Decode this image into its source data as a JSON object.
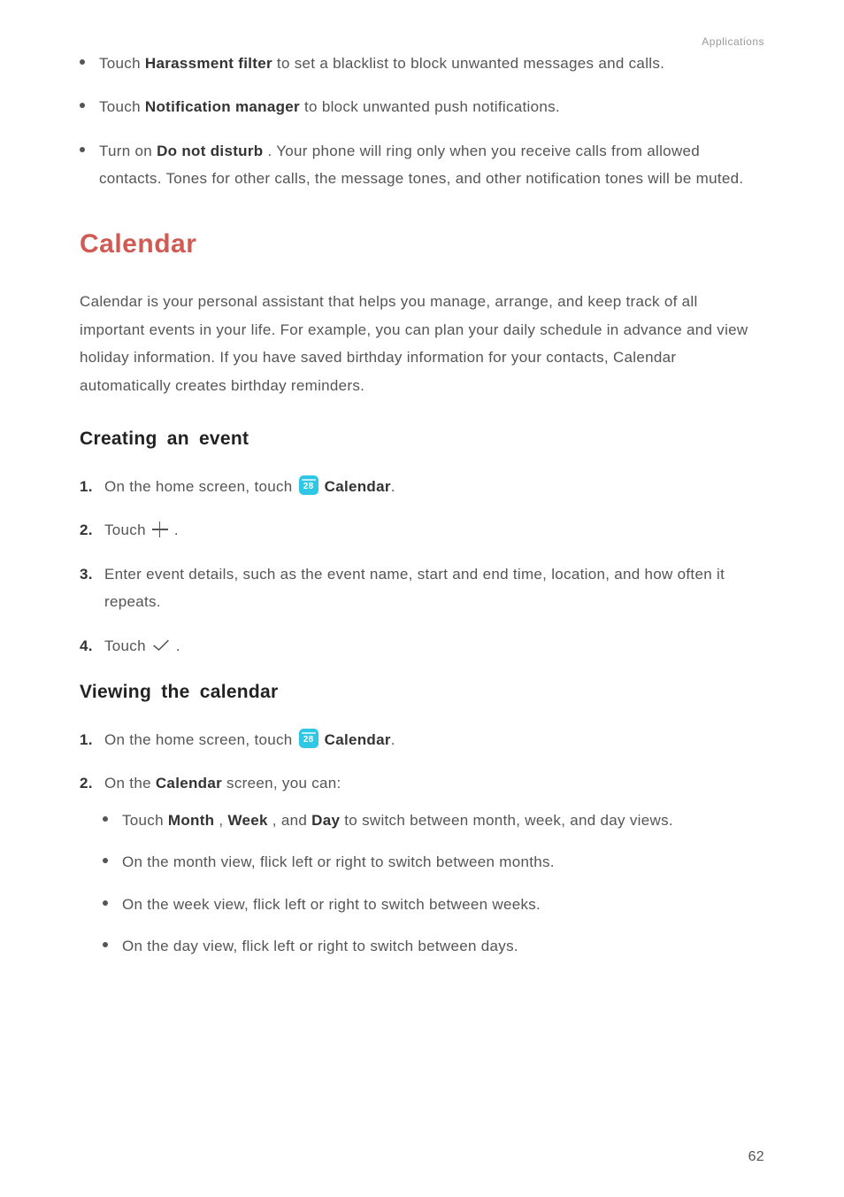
{
  "header": {
    "section_label": "Applications"
  },
  "top_bullets": [
    {
      "pre": "Touch ",
      "bold": "Harassment filter",
      "post": " to set a blacklist to block unwanted messages and calls."
    },
    {
      "pre": "Touch ",
      "bold": "Notification manager",
      "post": " to block unwanted push notifications."
    },
    {
      "pre": "Turn on ",
      "bold": "Do not disturb",
      "post": ". Your phone will ring only when you receive calls from allowed contacts. Tones for other calls, the message tones, and other notification tones will be muted."
    }
  ],
  "calendar": {
    "title": "Calendar",
    "intro": "Calendar is your personal assistant that helps you manage, arrange, and keep track of all important events in your life. For example, you can plan your daily schedule in advance and view holiday information. If you have saved birthday information for your contacts, Calendar automatically creates birthday reminders.",
    "icon_day": "28",
    "creating": {
      "title": "Creating an event",
      "steps": {
        "s1_pre": "On the home screen, touch ",
        "s1_label": "Calendar",
        "s2_pre": "Touch ",
        "s3": "Enter event details, such as the event name, start and end time, location, and how often it repeats.",
        "s4_pre": "Touch "
      }
    },
    "viewing": {
      "title": "Viewing the calendar",
      "s1_pre": "On the home screen, touch ",
      "s1_label": "Calendar",
      "s2_pre": "On the ",
      "s2_bold": "Calendar",
      "s2_post": " screen, you can:",
      "sub": [
        {
          "pre": "Touch ",
          "b1": "Month",
          "mid1": ", ",
          "b2": "Week",
          "mid2": ", and ",
          "b3": "Day",
          "post": " to switch between month, week, and day views."
        },
        {
          "text": "On the month view, flick left or right to switch between months."
        },
        {
          "text": "On the week view, flick left or right to switch between weeks."
        },
        {
          "text": "On the day view, flick left or right to switch between days."
        }
      ]
    }
  },
  "page_number": "62"
}
